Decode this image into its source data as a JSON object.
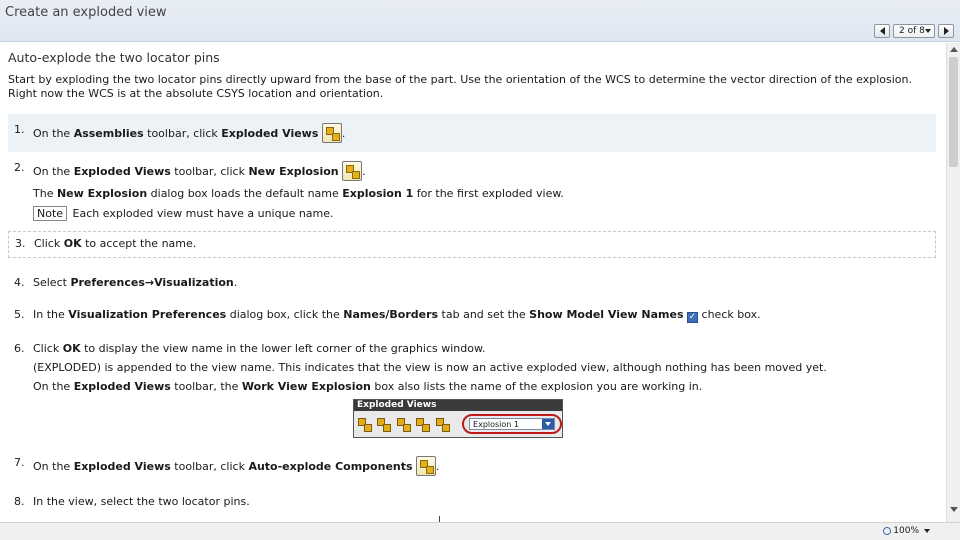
{
  "window": {
    "title": "Create an exploded view",
    "pager": {
      "current": "2 of 8"
    }
  },
  "section": {
    "heading": "Auto-explode the two locator pins",
    "intro": "Start by exploding the two locator pins directly upward from the base of the part. Use the orientation of the WCS to determine the vector direction of the explosion. Right now the WCS is at the absolute CSYS location and orientation."
  },
  "steps": {
    "s1": {
      "num": "1.",
      "a": "On the ",
      "b1": "Assemblies",
      "c": " toolbar, click ",
      "b2": "Exploded Views",
      "end": "."
    },
    "s2": {
      "num": "2.",
      "a": "On the ",
      "b1": "Exploded Views",
      "c": " toolbar, click ",
      "b2": "New Explosion",
      "end": ".",
      "sub1_a": "The ",
      "sub1_b1": "New Explosion",
      "sub1_c": " dialog box loads the default name ",
      "sub1_b2": "Explosion 1",
      "sub1_d": " for the first exploded view.",
      "note_label": "Note",
      "note_text": " Each exploded view must have a unique name."
    },
    "s3": {
      "num": "3.",
      "a": "Click ",
      "b1": "OK",
      "c": " to accept the name."
    },
    "s4": {
      "num": "4.",
      "a": "Select ",
      "b1": "Preferences→Visualization",
      "end": "."
    },
    "s5": {
      "num": "5.",
      "a": "In the ",
      "b1": "Visualization Preferences",
      "c": " dialog box, click the ",
      "b2": "Names/Borders",
      "d": " tab and set the ",
      "b3": "Show Model View Names",
      "e": " check box."
    },
    "s6": {
      "num": "6.",
      "a": "Click ",
      "b1": "OK",
      "c": " to display the view name in the lower left corner of the graphics window.",
      "sub1": "(EXPLODED) is appended to the view name. This indicates that the view is now an active exploded view, although nothing has been moved yet.",
      "sub2_a": "On the ",
      "sub2_b1": "Exploded Views",
      "sub2_c": " toolbar, the ",
      "sub2_b2": "Work View Explosion",
      "sub2_d": " box also lists the name of the explosion you are working in."
    },
    "s7": {
      "num": "7.",
      "a": "On the ",
      "b1": "Exploded Views",
      "c": " toolbar, click ",
      "b2": "Auto-explode Components",
      "end": "."
    },
    "s8": {
      "num": "8.",
      "a": "In the view, select the two locator pins."
    }
  },
  "toolbar_image": {
    "title": "Exploded Views",
    "combo_value": "Explosion 1"
  },
  "status": {
    "zoom": "100%"
  }
}
